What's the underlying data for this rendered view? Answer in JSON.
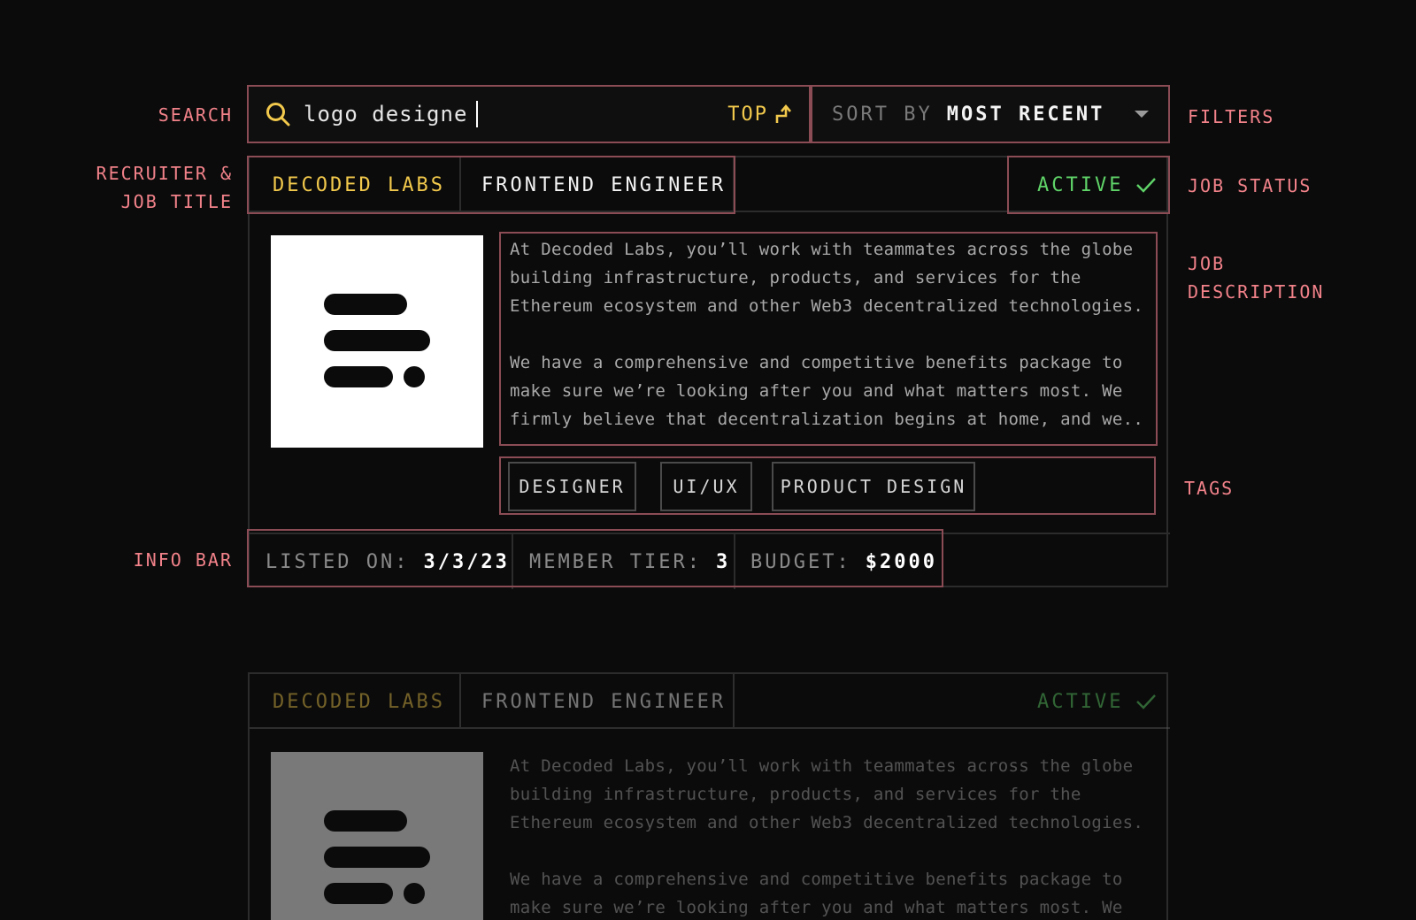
{
  "annotations": {
    "search": "SEARCH",
    "recruiter_line1": "RECRUITER &",
    "recruiter_line2": "JOB TITLE",
    "filters": "FILTERS",
    "job_status": "JOB STATUS",
    "job_desc_line1": "JOB",
    "job_desc_line2": "DESCRIPTION",
    "tags": "TAGS",
    "info_bar": "INFO BAR"
  },
  "search": {
    "value": "logo designe",
    "icon": "search-icon",
    "top_label": "TOP"
  },
  "sort": {
    "label": "SORT BY",
    "value": "MOST RECENT"
  },
  "colors": {
    "accent_yellow": "#f2c94c",
    "status_green": "#5fd368",
    "annotation_pink": "#f2828a",
    "frame_border": "#8b4c55"
  },
  "jobs": [
    {
      "recruiter": "DECODED LABS",
      "title": "FRONTEND ENGINEER",
      "status": "ACTIVE",
      "desc_p1": "At Decoded Labs, you’ll work with teammates across the globe building infrastructure, products, and services for the Ethereum ecosystem and other Web3 decentralized technologies.",
      "desc_p2": "We have a comprehensive and competitive benefits package to make sure we’re looking after you and what matters most. We firmly believe that decentralization begins at home, and we..",
      "tags": [
        "DESIGNER",
        "UI/UX",
        "PRODUCT DESIGN"
      ],
      "info": {
        "listed_label": "LISTED ON:",
        "listed_value": "3/3/23",
        "tier_label": "MEMBER TIER:",
        "tier_value": "3",
        "budget_label": "BUDGET:",
        "budget_value": "$2000"
      }
    },
    {
      "recruiter": "DECODED LABS",
      "title": "FRONTEND ENGINEER",
      "status": "ACTIVE",
      "desc_p1": "At Decoded Labs, you’ll work with teammates across the globe building infrastructure, products, and services for the Ethereum ecosystem and other Web3 decentralized technologies.",
      "desc_p2": "We have a comprehensive and competitive benefits package to make sure we’re looking after you and what matters most. We firmly"
    }
  ]
}
